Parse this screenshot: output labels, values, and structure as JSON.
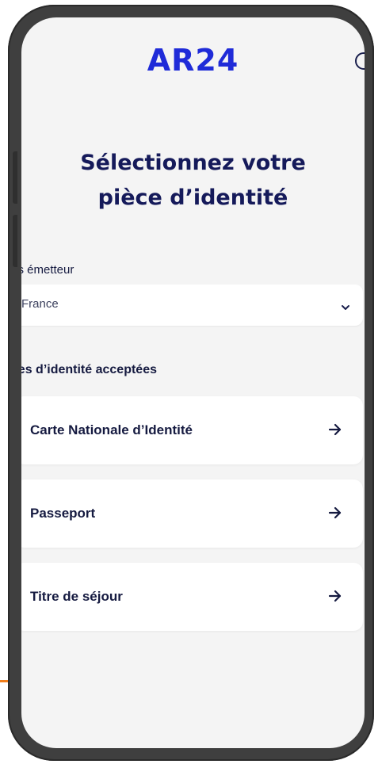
{
  "app": {
    "logo": "AR24"
  },
  "header": {
    "title_line1": "Sélectionnez votre",
    "title_line2": "pièce d’identité"
  },
  "country": {
    "label": "ys émetteur",
    "value": "France"
  },
  "documents": {
    "label": "èces d’identité acceptées",
    "items": [
      {
        "label": "Carte Nationale d’Identité"
      },
      {
        "label": "Passeport"
      },
      {
        "label": "Titre de séjour"
      }
    ]
  },
  "colors": {
    "brand": "#1f2bd8",
    "title": "#151a5a",
    "accent_orange": "#f07d1a",
    "phone_frame": "#3f3f3f",
    "screen_bg": "#f4f4f4"
  }
}
